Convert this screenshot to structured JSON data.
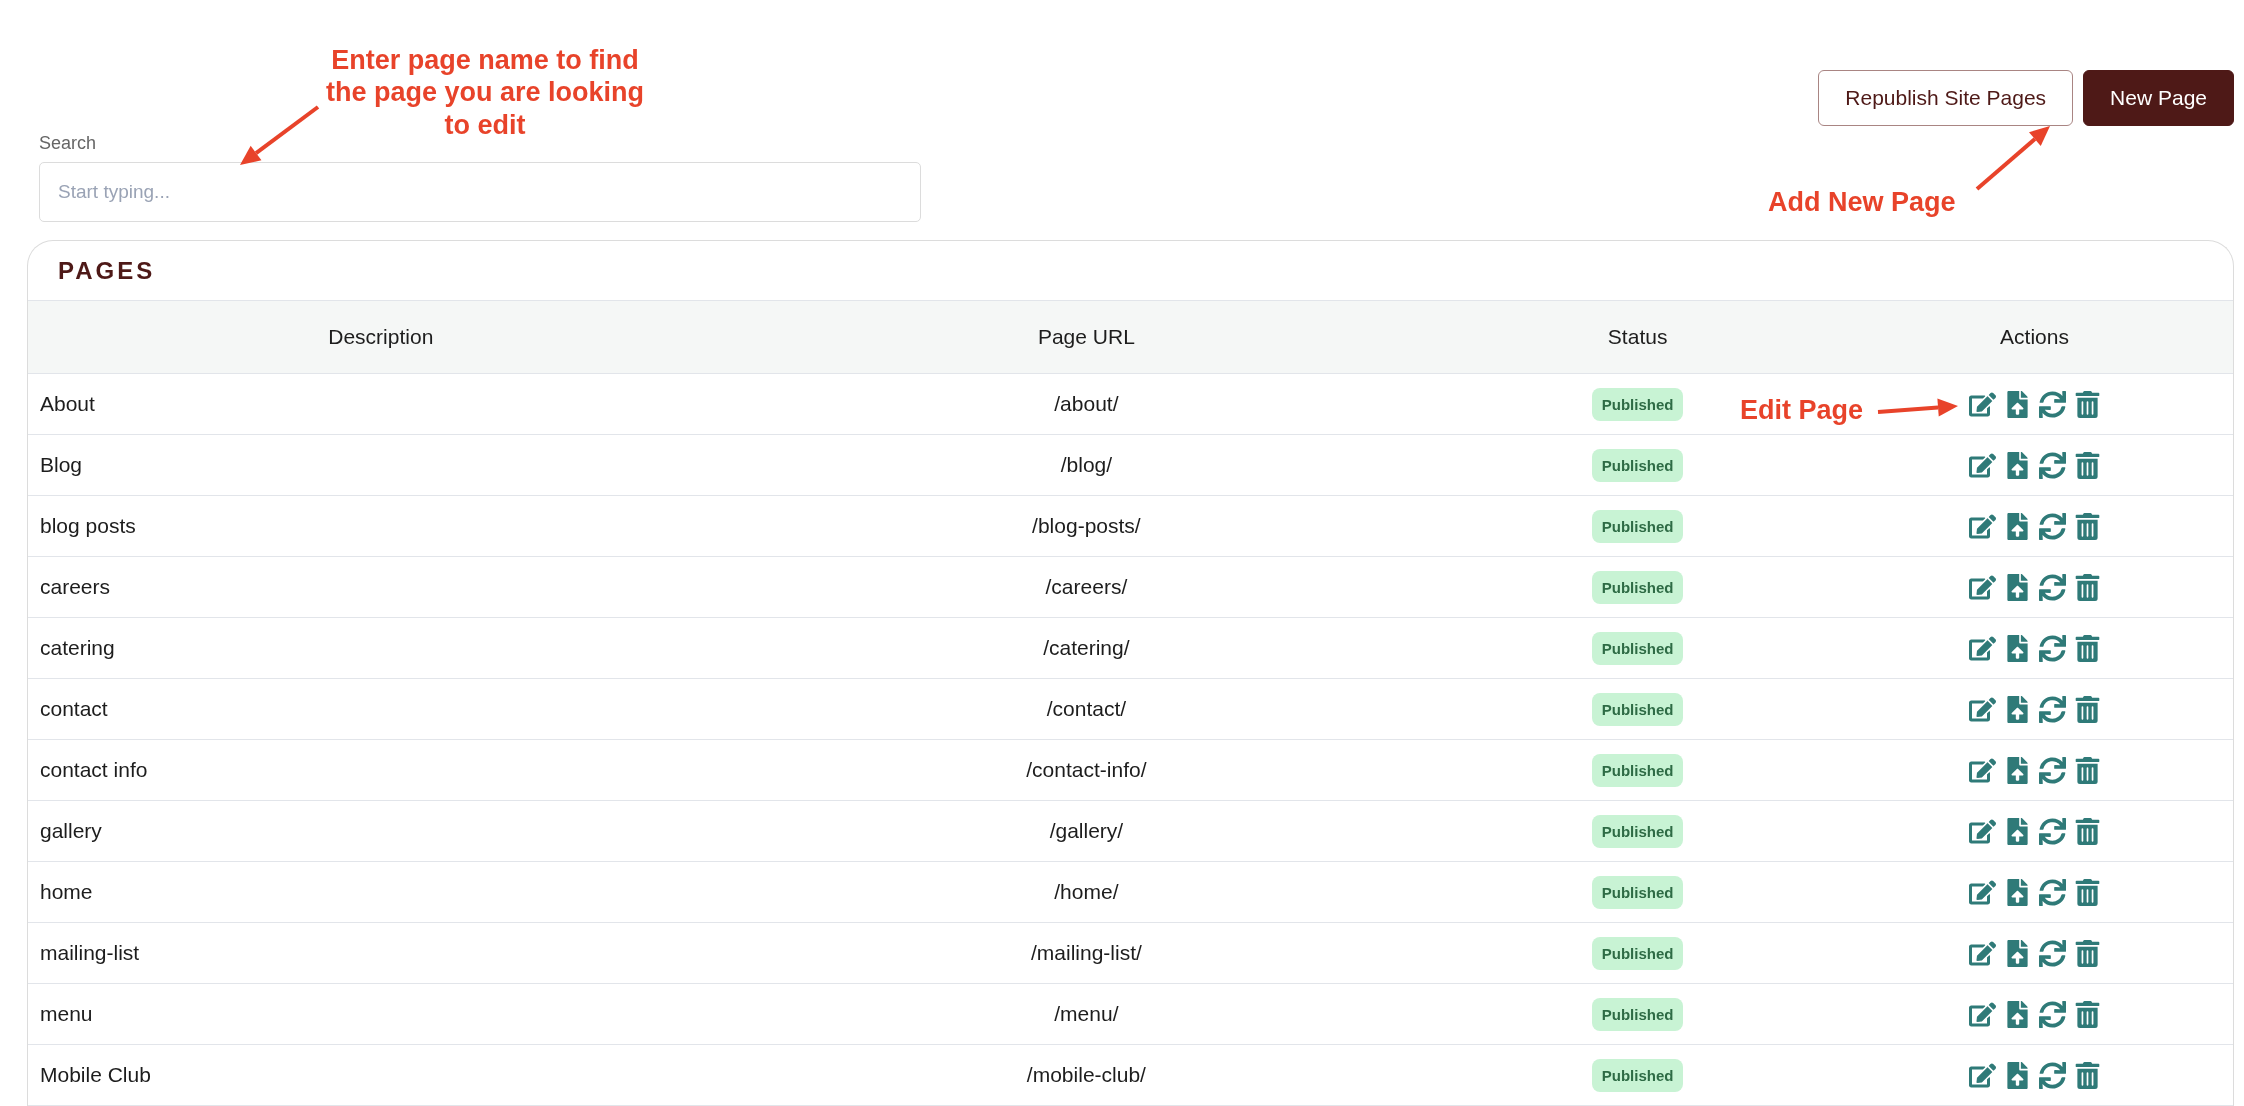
{
  "search": {
    "label": "Search",
    "placeholder": "Start typing..."
  },
  "buttons": [
    {
      "label": "Republish Site Pages",
      "kind": "outline"
    },
    {
      "label": "New Page",
      "kind": "primary"
    }
  ],
  "annotations": [
    "Enter page name to find the page you are looking to edit",
    "Add New Page",
    "Edit Page"
  ],
  "pages_card": {
    "title": "PAGES",
    "columns": [
      "Description",
      "Page URL",
      "Status",
      "Actions"
    ],
    "rows": [
      {
        "description": "About",
        "url": "/about/",
        "status": "Published"
      },
      {
        "description": "Blog",
        "url": "/blog/",
        "status": "Published"
      },
      {
        "description": "blog posts",
        "url": "/blog-posts/",
        "status": "Published"
      },
      {
        "description": "careers",
        "url": "/careers/",
        "status": "Published"
      },
      {
        "description": "catering",
        "url": "/catering/",
        "status": "Published"
      },
      {
        "description": "contact",
        "url": "/contact/",
        "status": "Published"
      },
      {
        "description": "contact info",
        "url": "/contact-info/",
        "status": "Published"
      },
      {
        "description": "gallery",
        "url": "/gallery/",
        "status": "Published"
      },
      {
        "description": "home",
        "url": "/home/",
        "status": "Published"
      },
      {
        "description": "mailing-list",
        "url": "/mailing-list/",
        "status": "Published"
      },
      {
        "description": "menu",
        "url": "/menu/",
        "status": "Published"
      },
      {
        "description": "Mobile Club",
        "url": "/mobile-club/",
        "status": "Published"
      }
    ]
  }
}
